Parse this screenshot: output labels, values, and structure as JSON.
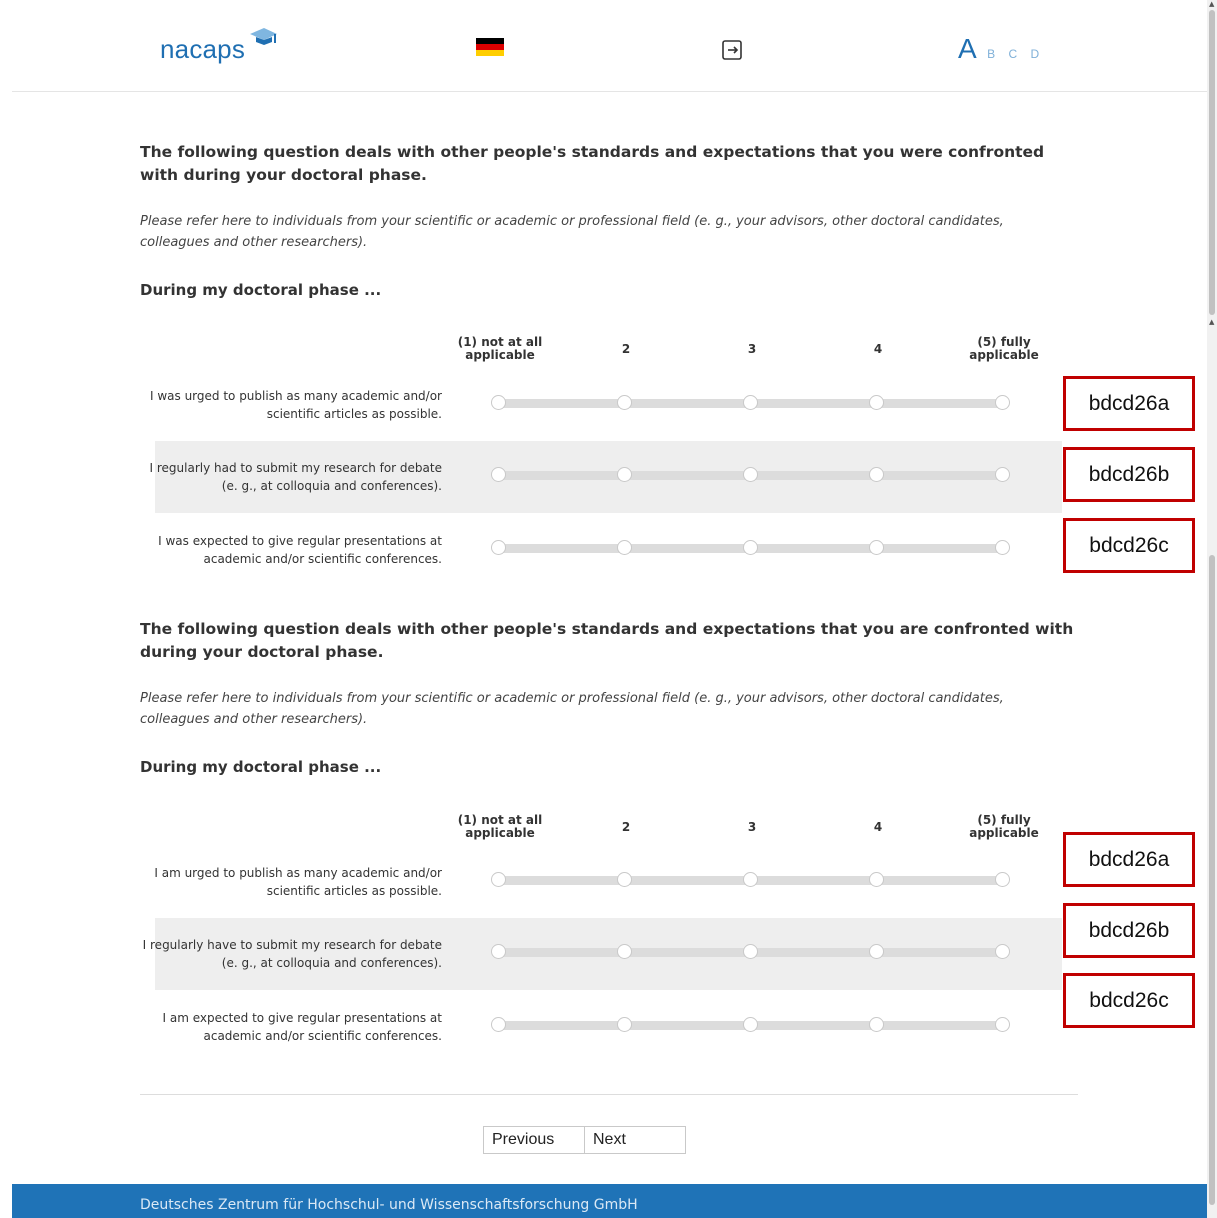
{
  "header": {
    "logo_text": "nacaps",
    "level_current": "A",
    "level_others": "B C D"
  },
  "sections": [
    {
      "title": "The following question deals with other people's standards and expectations that you were confronted with during your doctoral phase.",
      "note": "Please refer here to individuals from your scientific or academic or professional field (e. g., your advisors, other doctoral candidates, colleagues and other researchers).",
      "stem": "During my doctoral phase ...",
      "scale": [
        "(1) not at all applicable",
        "2",
        "3",
        "4",
        "(5) fully applicable"
      ],
      "items": [
        {
          "label": "I was urged to publish as many academic and/or scientific articles as possible.",
          "code": "bdcd26a"
        },
        {
          "label": "I regularly had to submit my research for debate (e. g., at colloquia and conferences).",
          "code": "bdcd26b"
        },
        {
          "label": "I was expected to give regular presentations at academic and/or scientific conferences.",
          "code": "bdcd26c"
        }
      ]
    },
    {
      "title": "The following question deals with other people's standards and expectations that you are confronted with during your doctoral phase.",
      "note": "Please refer here to individuals from your scientific or academic or professional field (e. g., your advisors, other doctoral candidates, colleagues and other researchers).",
      "stem": "During my doctoral phase ...",
      "scale": [
        "(1) not at all applicable",
        "2",
        "3",
        "4",
        "(5) fully applicable"
      ],
      "items": [
        {
          "label": "I am urged to publish as many academic and/or scientific articles as possible.",
          "code": "bdcd26a"
        },
        {
          "label": "I regularly have to submit my research for debate (e. g., at colloquia and conferences).",
          "code": "bdcd26b"
        },
        {
          "label": "I am expected to give regular presentations at academic and/or scientific conferences.",
          "code": "bdcd26c"
        }
      ]
    }
  ],
  "nav": {
    "previous": "Previous",
    "next": "Next"
  },
  "footer": {
    "text": "Deutsches Zentrum für Hochschul- und Wissenschaftsforschung GmbH"
  },
  "colors": {
    "brand": "#1f73b7",
    "annotation_border": "#c00000"
  }
}
